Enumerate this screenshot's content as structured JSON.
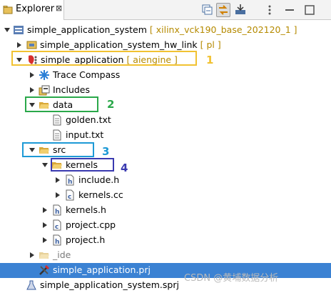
{
  "tab": {
    "title": "Explorer",
    "close_glyph": "⊠"
  },
  "toolbar": {
    "buttons": [
      "collapse-all-icon",
      "link-with-editor-icon",
      "import-icon",
      "view-menu-icon",
      "minimize-icon",
      "maximize-icon"
    ]
  },
  "tree": {
    "system_name": "simple_application_system",
    "system_deco": "[ xilinx_vck190_base_202120_1 ]",
    "hw_link_name": "simple_application_system_hw_link",
    "hw_link_deco": "[ pl ]",
    "app_name": "simple_application",
    "app_deco": "[ aiengine ]",
    "trace": "Trace Compass",
    "includes": "Includes",
    "data": "data",
    "golden": "golden.txt",
    "input": "input.txt",
    "src": "src",
    "kernels": "kernels",
    "include_h": "include.h",
    "kernels_cc": "kernels.cc",
    "kernels_h": "kernels.h",
    "project_cpp": "project.cpp",
    "project_h": "project.h",
    "ide": "_ide",
    "prj": "simple_application.prj",
    "sprj": "simple_application_system.sprj"
  },
  "annotations": [
    {
      "num": "1",
      "color": "#f1c232"
    },
    {
      "num": "2",
      "color": "#2aa84a"
    },
    {
      "num": "3",
      "color": "#1e9ad6"
    },
    {
      "num": "4",
      "color": "#3a3ab0"
    }
  ],
  "watermark": "CSDN @黄埔数据分析"
}
